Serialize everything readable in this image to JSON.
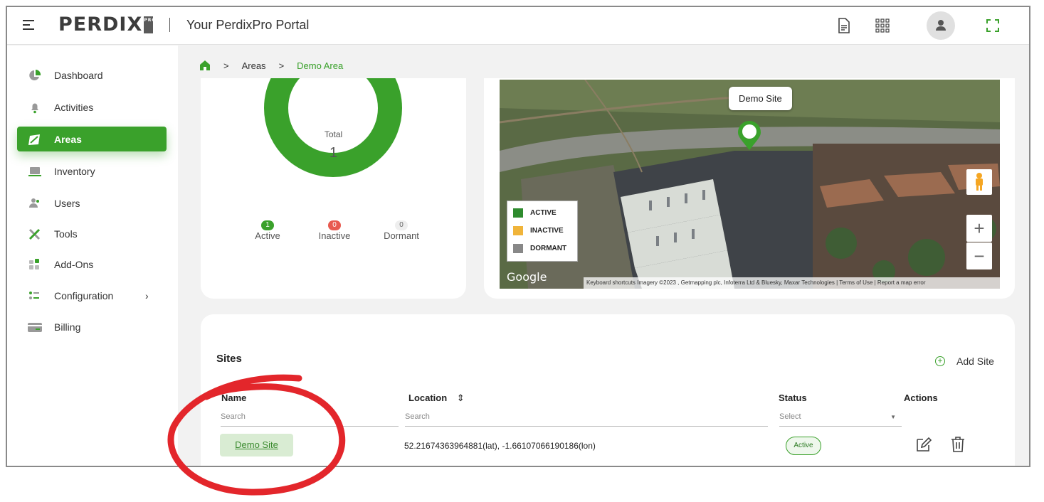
{
  "header": {
    "logo_text": "PERDIX",
    "logo_badge": "PRO",
    "portal_title": "Your PerdixPro Portal",
    "icons": [
      "menu-icon",
      "document-icon",
      "apps-grid-icon",
      "user-avatar-icon",
      "fullscreen-icon"
    ]
  },
  "sidebar": {
    "items": [
      {
        "label": "Dashboard",
        "icon": "pie-chart-icon"
      },
      {
        "label": "Activities",
        "icon": "bell-icon"
      },
      {
        "label": "Areas",
        "icon": "area-map-icon",
        "active": true
      },
      {
        "label": "Inventory",
        "icon": "laptop-icon"
      },
      {
        "label": "Users",
        "icon": "users-icon"
      },
      {
        "label": "Tools",
        "icon": "tools-icon"
      },
      {
        "label": "Add-Ons",
        "icon": "addons-icon"
      },
      {
        "label": "Configuration",
        "icon": "config-icon",
        "chevron": "›"
      },
      {
        "label": "Billing",
        "icon": "card-icon"
      }
    ]
  },
  "breadcrumb": {
    "separator": ">",
    "items": [
      "Areas",
      "Demo Area"
    ]
  },
  "summary": {
    "center_label": "Total",
    "center_value": "1",
    "legend": [
      {
        "label": "Active",
        "count": "1",
        "color": "#3aa12b"
      },
      {
        "label": "Inactive",
        "count": "0",
        "color": "#e85a4f"
      },
      {
        "label": "Dormant",
        "count": "0",
        "color": "#eeeeee"
      }
    ]
  },
  "map": {
    "marker_label": "Demo Site",
    "legend": [
      {
        "label": "ACTIVE",
        "color": "#2e8b2e"
      },
      {
        "label": "INACTIVE",
        "color": "#f0b43a"
      },
      {
        "label": "DORMANT",
        "color": "#888888"
      }
    ],
    "zoom_in": "+",
    "zoom_out": "−",
    "google_text": "Google",
    "attribution": "Keyboard shortcuts   Imagery ©2023 , Getmapping plc, Infoterra Ltd & Bluesky, Maxar Technologies  |  Terms of Use  |  Report a map error"
  },
  "sites": {
    "title": "Sites",
    "add_label": "Add Site",
    "columns": {
      "name": "Name",
      "name_filter": "Search",
      "location": "Location",
      "location_sort": "⇕",
      "location_filter": "Search",
      "status": "Status",
      "status_filter": "Select",
      "actions": "Actions"
    },
    "rows": [
      {
        "name": "Demo Site",
        "location": "52.21674363964881(lat), -1.66107066190186(lon)",
        "status": "Active"
      }
    ]
  },
  "colors": {
    "accent": "#3aa12b",
    "annotation": "#e3262b"
  }
}
